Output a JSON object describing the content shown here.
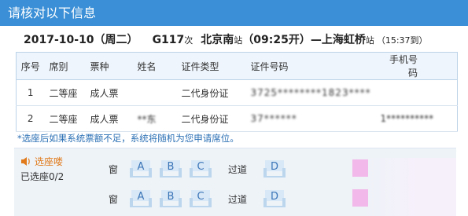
{
  "title": "请核对以下信息",
  "trip": {
    "date": "2017-10-10（周二）",
    "train_no": "G117",
    "train_suffix": "次",
    "from_station": "北京南",
    "from_suffix": "站",
    "depart": "（09:25开）",
    "arrow": "—",
    "to_station": "上海虹桥",
    "to_suffix": "站",
    "arrive": "（15:37到）"
  },
  "table": {
    "headers": [
      "序号",
      "席别",
      "票种",
      "姓名",
      "证件类型",
      "证件号码",
      "手机号码"
    ],
    "rows": [
      {
        "no": "1",
        "seat": "二等座",
        "ticket": "成人票",
        "name": "",
        "id_type": "二代身份证",
        "id_no": "3725********1823****",
        "phone": ""
      },
      {
        "no": "2",
        "seat": "二等座",
        "ticket": "成人票",
        "name": "**东",
        "id_type": "二代身份证",
        "id_no": "37******",
        "phone": "1**********"
      }
    ]
  },
  "notice": "*选座后如果系统票额不足，系统将随机为您申请席位。",
  "seat_select": {
    "label": "选座喽",
    "count": "已选座0/2",
    "window": "窗",
    "aisle": "过道",
    "left_seats": [
      "A",
      "B",
      "C"
    ],
    "right_seats": [
      "D"
    ]
  },
  "colors": {
    "titlebar": "#3a8fd6",
    "seat_icon": "#bcd6ee",
    "seat_letter": "#3a75b8",
    "notice": "#2a6fb4",
    "accent": "#e07a1a"
  }
}
